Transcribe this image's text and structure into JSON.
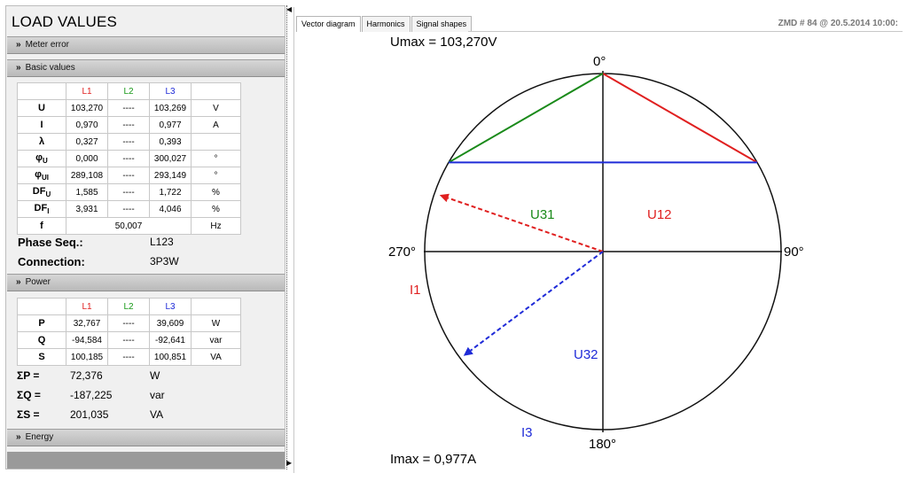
{
  "panel": {
    "title": "LOAD VALUES"
  },
  "sections": {
    "meter_error": "Meter error",
    "basic_values": "Basic values",
    "power": "Power",
    "energy": "Energy"
  },
  "basic_table": {
    "headers": [
      "L1",
      "L2",
      "L3"
    ],
    "rows": [
      {
        "label": "U",
        "l1": "103,270",
        "l2": "----",
        "l3": "103,269",
        "unit": "V"
      },
      {
        "label": "I",
        "l1": "0,970",
        "l2": "----",
        "l3": "0,977",
        "unit": "A"
      },
      {
        "label": "λ",
        "l1": "0,327",
        "l2": "----",
        "l3": "0,393",
        "unit": ""
      },
      {
        "label": "φU",
        "l1": "0,000",
        "l2": "----",
        "l3": "300,027",
        "unit": "°"
      },
      {
        "label": "φUI",
        "l1": "289,108",
        "l2": "----",
        "l3": "293,149",
        "unit": "°"
      },
      {
        "label": "DFU",
        "l1": "1,585",
        "l2": "----",
        "l3": "1,722",
        "unit": "%"
      },
      {
        "label": "DFI",
        "l1": "3,931",
        "l2": "----",
        "l3": "4,046",
        "unit": "%"
      }
    ],
    "freq": {
      "label": "f",
      "value": "50,007",
      "unit": "Hz"
    }
  },
  "phase_seq": {
    "label": "Phase Seq.:",
    "value": "L123"
  },
  "connection": {
    "label": "Connection:",
    "value": "3P3W"
  },
  "power_table": {
    "headers": [
      "L1",
      "L2",
      "L3"
    ],
    "rows": [
      {
        "label": "P",
        "l1": "32,767",
        "l2": "----",
        "l3": "39,609",
        "unit": "W"
      },
      {
        "label": "Q",
        "l1": "-94,584",
        "l2": "----",
        "l3": "-92,641",
        "unit": "var"
      },
      {
        "label": "S",
        "l1": "100,185",
        "l2": "----",
        "l3": "100,851",
        "unit": "VA"
      }
    ]
  },
  "sums": [
    {
      "label": "ΣP =",
      "value": "72,376",
      "unit": "W"
    },
    {
      "label": "ΣQ =",
      "value": "-187,225",
      "unit": "var"
    },
    {
      "label": "ΣS =",
      "value": "201,035",
      "unit": "VA"
    }
  ],
  "tabs": [
    "Vector diagram",
    "Harmonics",
    "Signal shapes"
  ],
  "meter_id": "ZMD # 84 @ 20.5.2014 10:00:",
  "vector": {
    "umax": "Umax = 103,270V",
    "imax": "Imax = 0,977A",
    "angles": {
      "top": "0°",
      "right": "90°",
      "bottom": "180°",
      "left": "270°"
    },
    "labels": {
      "u12": "U12",
      "u31": "U31",
      "u32": "U32",
      "i1": "I1",
      "i3": "I3"
    },
    "colors": {
      "l1": "#e02020",
      "l2": "#1a8a1a",
      "l3": "#1f2bd8"
    },
    "voltage_angles_deg": {
      "u1": 0,
      "u3": 300.027
    },
    "current_angles_deg": {
      "i1": 289.108,
      "i3": 593.176
    },
    "current_magnitudes": {
      "i1": 0.97,
      "i3": 0.977
    }
  }
}
